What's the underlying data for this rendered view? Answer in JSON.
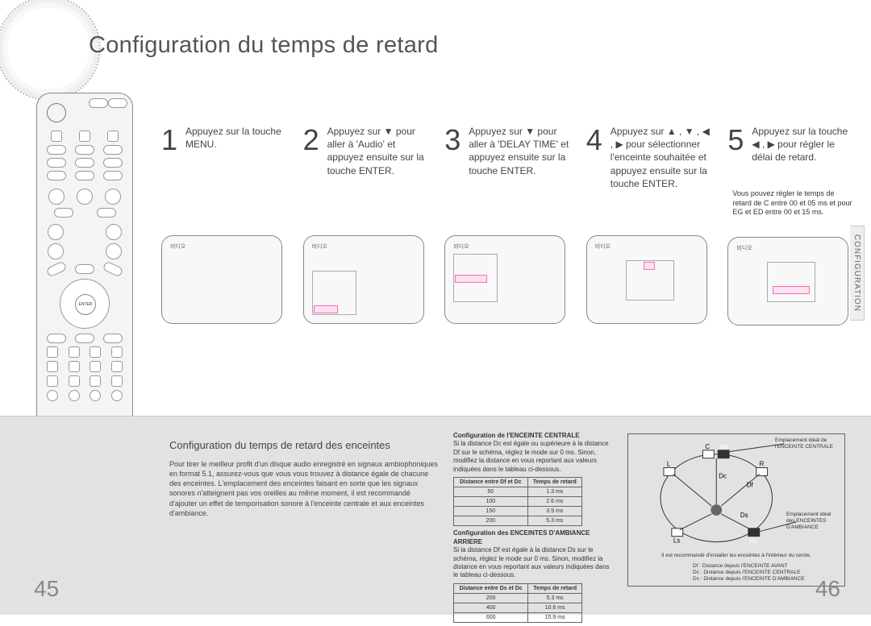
{
  "title": "Configuration du temps de retard",
  "side_tab": "CONFIGURATION",
  "page_left": "45",
  "page_right": "46",
  "remote": {
    "enter_label": "ENTER"
  },
  "steps": [
    {
      "num": "1",
      "text": "Appuyez sur la touche MENU."
    },
    {
      "num": "2",
      "text": "Appuyez sur ▼ pour aller à 'Audio' et appuyez ensuite sur la touche ENTER."
    },
    {
      "num": "3",
      "text": "Appuyez sur ▼ pour aller à 'DELAY TIME' et appuyez ensuite sur la touche ENTER."
    },
    {
      "num": "4",
      "text": "Appuyez sur ▲ , ▼ , ◀ , ▶ pour sélectionner l'enceinte souhaitée et appuyez ensuite sur la touche ENTER."
    },
    {
      "num": "5",
      "text": "Appuyez sur la touche ◀ , ▶ pour régler le délai de retard.",
      "note": "Vous pouvez régler le temps de retard de C entre 00 et 05 ms et pour EG et ED entre 00 et 15 ms."
    }
  ],
  "screen_label": "비디오",
  "lower": {
    "section_title": "Configuration du temps de retard des enceintes",
    "section_body": "Pour tirer le meilleur profit d'un disque audio enregistré en signaux ambiophoniques en format 5.1, assurez-vous que vous vous trouvez à distance égale de chacune des enceintes. L'emplacement des enceintes faisant en sorte que les signaux sonores n'atteignent pas vos oreilles au même moment, il est recommandé d'ajouter un effet de temporisation sonore à l'enceinte centrale et aux enceintes d'ambiance.",
    "center_title": "Configuration de l'ENCEINTE CENTRALE",
    "center_text": "Si la distance Dc est égale ou supérieure à la distance Df sur le schéma, réglez le mode sur 0 ms. Sinon, modifiez la distance en vous reportant aux valeurs indiquées dans le tableau ci-dessous.",
    "rear_title": "Configuration des ENCEINTES D'AMBIANCE ARRIERE",
    "rear_text": "Si la distance Df est égale à la distance Ds sur le schéma, réglez le mode sur 0 ms. Sinon, modifiez la distance en vous reportant aux valeurs indiquées dans le tableau ci-dessous.",
    "table1": {
      "headers": [
        "Distance entre Df et Dc",
        "Temps de retard"
      ],
      "rows": [
        [
          "50",
          "1.3 ms"
        ],
        [
          "100",
          "2.6 ms"
        ],
        [
          "150",
          "3.9 ms"
        ],
        [
          "200",
          "5.3 ms"
        ]
      ]
    },
    "table2": {
      "headers": [
        "Distance entre Ds et Dc",
        "Temps de retard"
      ],
      "rows": [
        [
          "200",
          "5.3 ms"
        ],
        [
          "400",
          "10.6 ms"
        ],
        [
          "600",
          "15.9 ms"
        ]
      ]
    },
    "diagram": {
      "note_top": "Emplacement idéal de l'ENCEINTE CENTRALE",
      "note_right": "Emplacement idéal des ENCEINTES D'AMBIANCE",
      "legend_foot": "Il est recommandé d'installer les enceintes à l'intérieur du cercle.",
      "legend_df": "Df : Distance depuis l'ENCEINTE AVANT",
      "legend_dc": "Dc : Distance depuis l'ENCEINTE CENTRALE",
      "legend_ds": "Ds : Distance depuis l'ENCEINTE D'AMBIANCE",
      "labels": {
        "L": "L",
        "C": "C",
        "SW": "SW",
        "R": "R",
        "Dc": "Dc",
        "Df": "Df",
        "Ds": "Ds",
        "Ls": "Ls",
        "Rs": "Rs"
      }
    }
  }
}
